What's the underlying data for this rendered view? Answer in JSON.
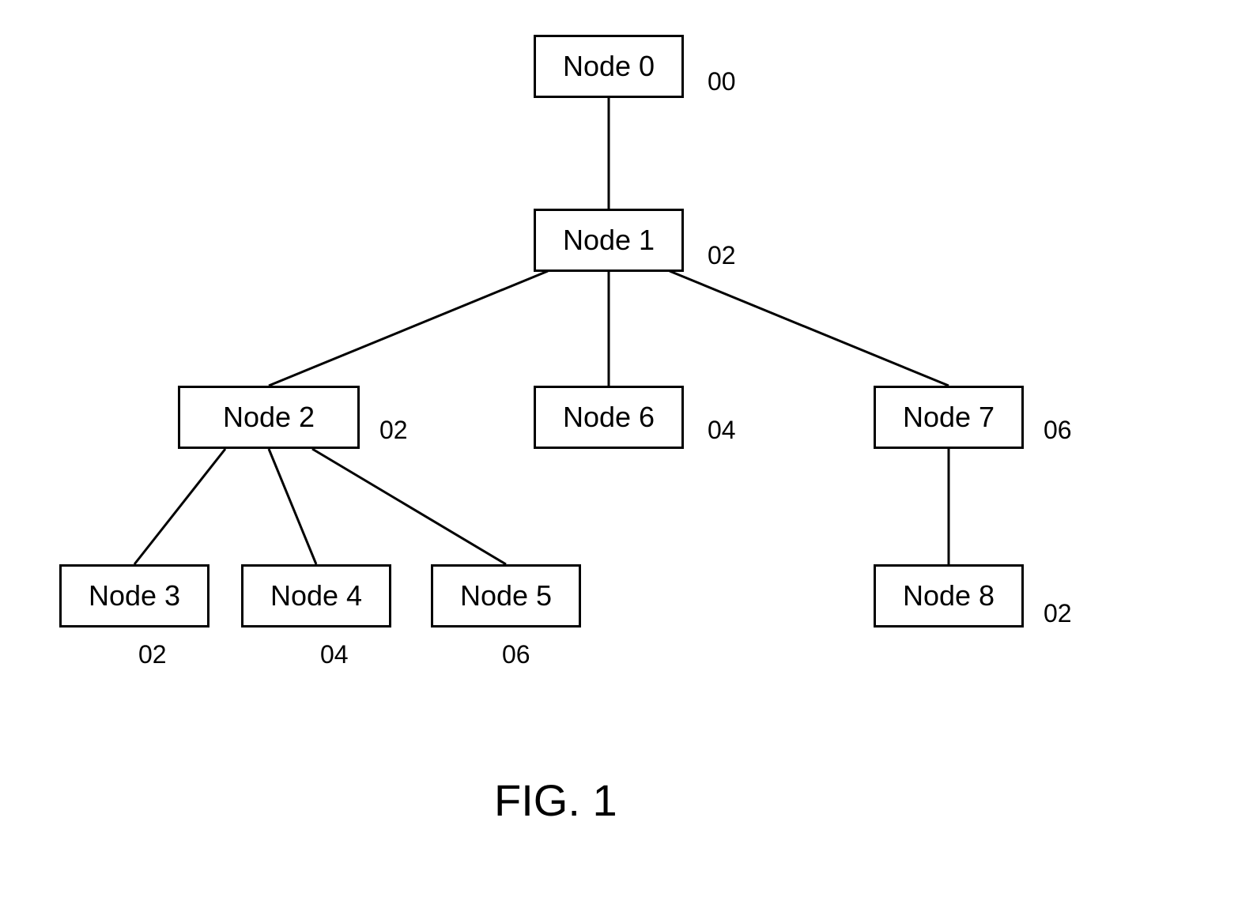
{
  "nodes": {
    "n0": {
      "label": "Node 0",
      "ref": "00"
    },
    "n1": {
      "label": "Node 1",
      "ref": "02"
    },
    "n2": {
      "label": "Node 2",
      "ref": "02"
    },
    "n3": {
      "label": "Node 3",
      "ref": "02"
    },
    "n4": {
      "label": "Node 4",
      "ref": "04"
    },
    "n5": {
      "label": "Node 5",
      "ref": "06"
    },
    "n6": {
      "label": "Node 6",
      "ref": "04"
    },
    "n7": {
      "label": "Node 7",
      "ref": "06"
    },
    "n8": {
      "label": "Node 8",
      "ref": "02"
    }
  },
  "figure": "FIG. 1"
}
